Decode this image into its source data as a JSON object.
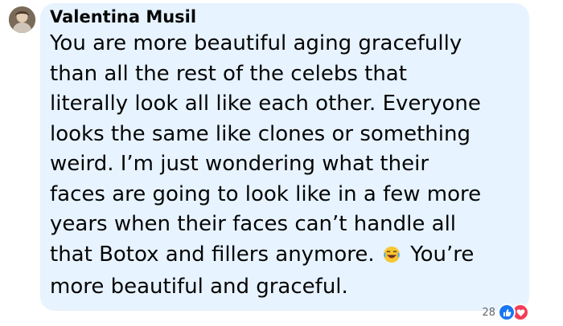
{
  "comment": {
    "author": "Valentina Musil",
    "text_before_emoji": "You are more beautiful aging gracefully\nthan all the rest of the celebs that\nliterally look all like each other. Everyone\nlooks the same like clones or something\nweird. I’m just wondering what their\nfaces are going to look like in a few more\nyears when their faces can’t handle all\nthat Botox and fillers anymore.",
    "emoji_icon": "laughing-face-emoji",
    "text_after_emoji": "You’re\nmore beautiful and graceful."
  },
  "reactions": {
    "count": "28",
    "icons": [
      "like-icon",
      "love-icon"
    ],
    "colors": {
      "like": "#1877f2",
      "love": "#f33e58"
    }
  },
  "colors": {
    "bubble": "#e7f3ff",
    "text": "#050505",
    "meta": "#65676b"
  }
}
